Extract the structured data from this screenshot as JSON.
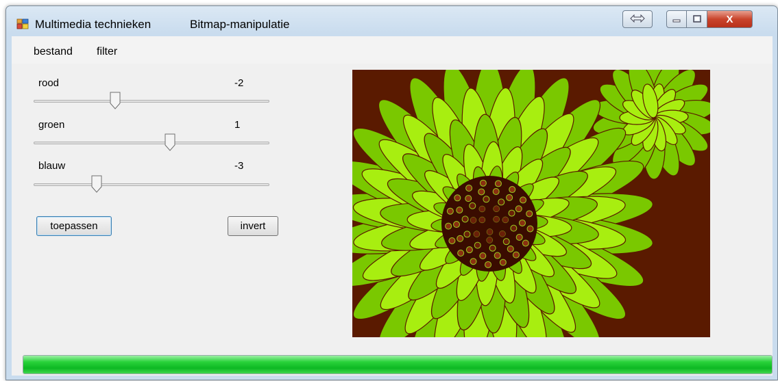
{
  "window": {
    "app_title": "Multimedia technieken",
    "subtitle": "Bitmap-manipulatie",
    "icons": {
      "app": "app-form-icon",
      "swap": "resize-arrows-icon",
      "minimize": "minimize-icon",
      "maximize": "maximize-icon",
      "close": "close-icon"
    },
    "close_glyph": "X"
  },
  "menu": {
    "items": [
      {
        "label": "bestand"
      },
      {
        "label": "filter"
      }
    ]
  },
  "sliders": [
    {
      "label": "rood",
      "value": "-2",
      "min": -5,
      "max": 5
    },
    {
      "label": "groen",
      "value": "1",
      "min": -5,
      "max": 5
    },
    {
      "label": "blauw",
      "value": "-3",
      "min": -5,
      "max": 5
    }
  ],
  "buttons": {
    "apply_label": "toepassen",
    "invert_label": "invert"
  },
  "image": {
    "subject": "chrysanthemum-flower",
    "colors": {
      "background": "#5a1a00",
      "petal": "#7ac800",
      "petal_light": "#a8ee10",
      "center": "#3a0c00"
    }
  },
  "progress": {
    "value": 1.0,
    "color": "#12c42a"
  }
}
